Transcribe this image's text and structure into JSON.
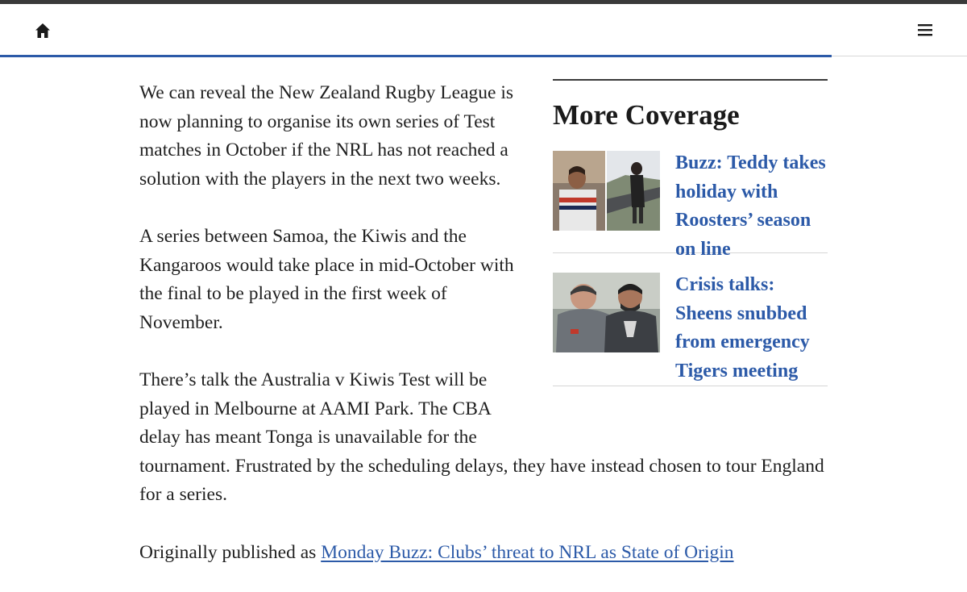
{
  "header": {
    "home_icon": "home-icon",
    "menu_icon": "hamburger-menu-icon"
  },
  "article": {
    "paragraphs": [
      "We can reveal the New Zealand Rugby League is now planning to organise its own series of Test matches in October if the NRL has not reached a solution with the players in the next two weeks.",
      "A series between Samoa, the Kiwis and the Kangaroos would take place in mid-October with the final to be played in the first week of November."
    ],
    "paragraph3": {
      "part1": "There’s talk the Australia v Kiwis Test will be played in Melbourne at AAMI Park. The CBA delay has meant Tonga is unavailable for the",
      "part2": "tournament. Frustrated by the scheduling delays, they have instead chosen to tour England for a series."
    },
    "originally_published_prefix": "Originally published as ",
    "originally_published_link": "Monday Buzz: Clubs’ threat to NRL as State of Origin"
  },
  "sidebar": {
    "heading": "More Coverage",
    "items": [
      {
        "title": "Buzz: Teddy takes holiday with Roosters’ season on line"
      },
      {
        "title": "Crisis talks: Sheens snubbed from emergency Tigers meeting"
      }
    ]
  },
  "colors": {
    "accent_blue": "#2c5aa8",
    "text": "#1f1f1f",
    "top_strip": "#3a3a3a"
  }
}
